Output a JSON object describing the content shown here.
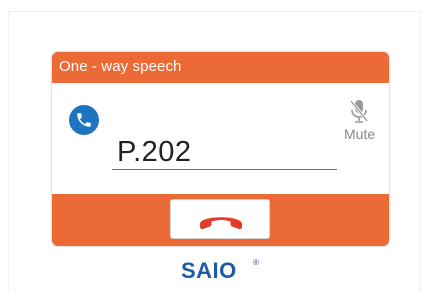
{
  "dialog": {
    "title": "One - way speech",
    "caller": "P.202",
    "mute_label": "Mute"
  },
  "icons": {
    "call": "phone-icon",
    "mute": "microphone-muted-icon",
    "hangup": "phone-hangup-icon"
  },
  "brand": {
    "name": "SAIO",
    "mark": "®"
  },
  "colors": {
    "accent": "#eb6a35",
    "call_icon": "#1f74bf",
    "hangup": "#e53a2a",
    "brand": "#1e5aa8"
  }
}
